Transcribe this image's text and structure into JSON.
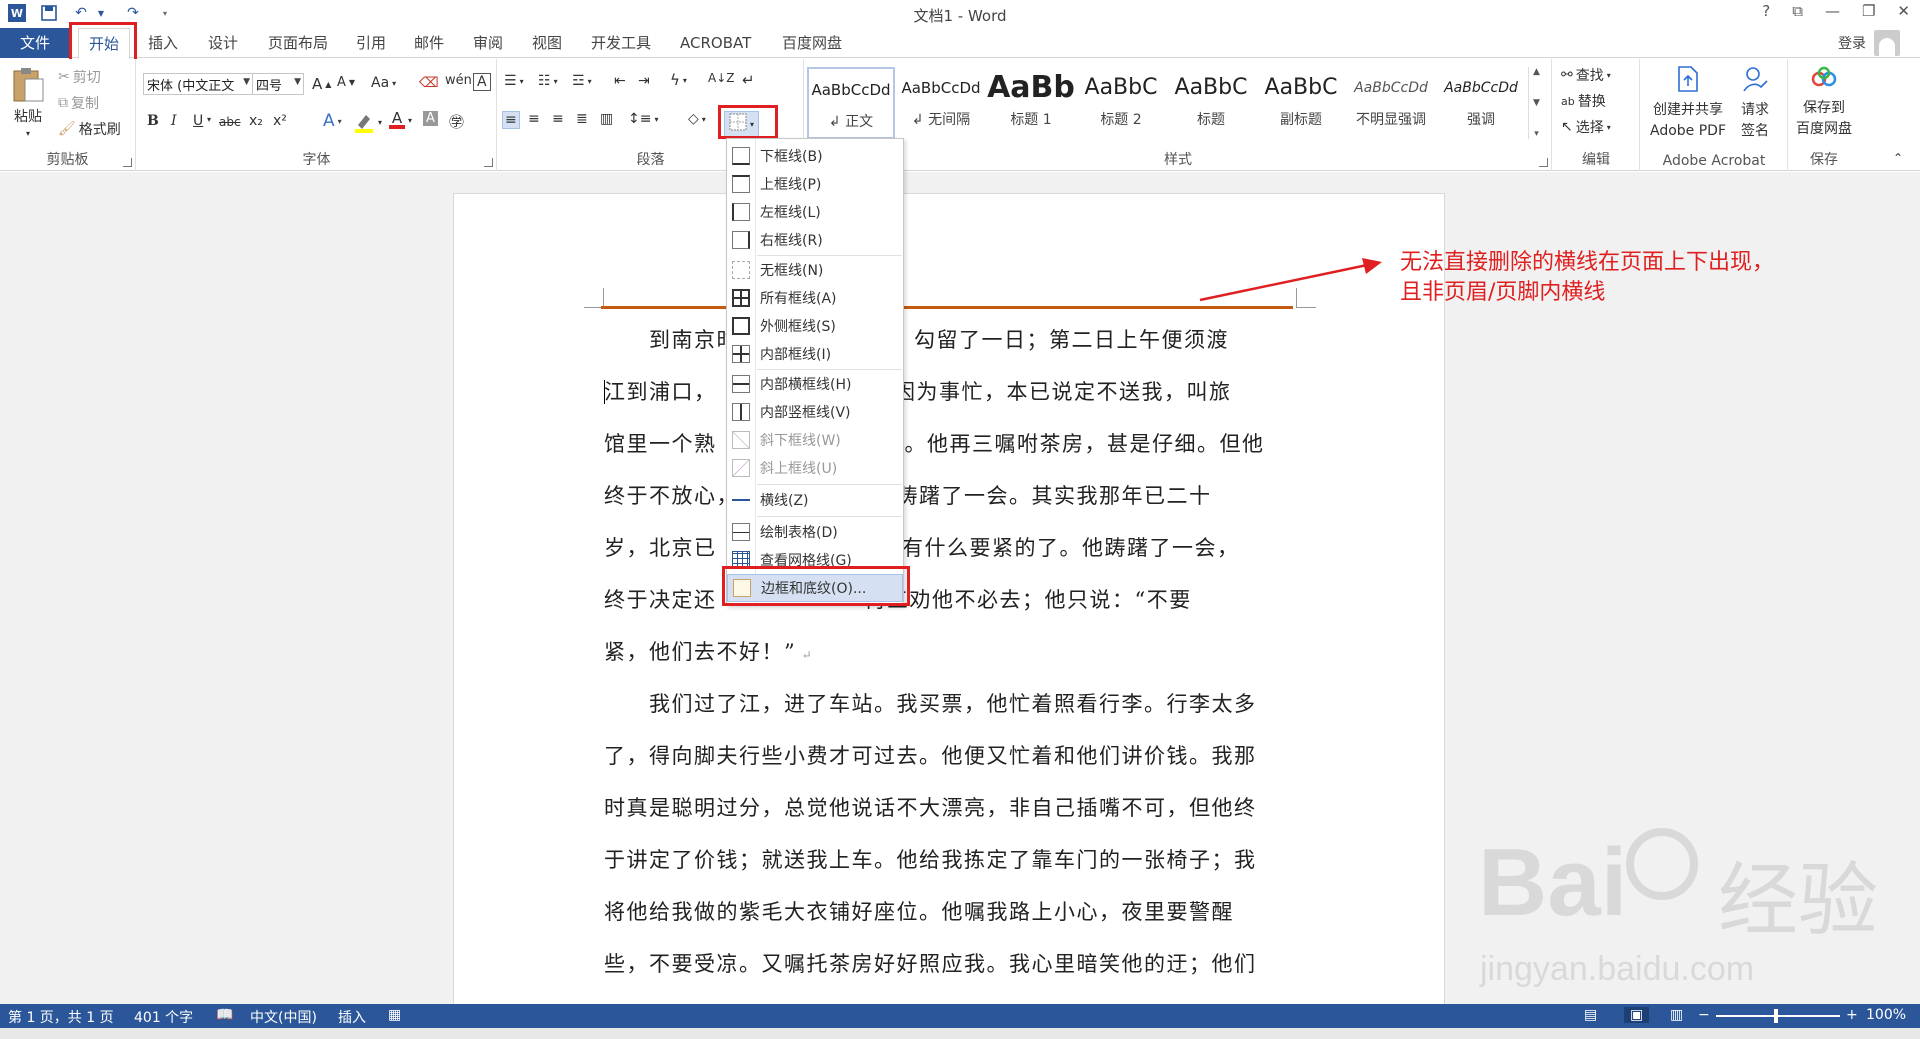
{
  "window": {
    "title": "文档1 - Word",
    "help": "?",
    "restore_icon": "ribbon-display-icon",
    "login": "登录"
  },
  "tabs": [
    "文件",
    "开始",
    "插入",
    "设计",
    "页面布局",
    "引用",
    "邮件",
    "审阅",
    "视图",
    "开发工具",
    "ACROBAT",
    "百度网盘"
  ],
  "clipboard": {
    "paste": "粘贴",
    "cut": "剪切",
    "copy": "复制",
    "format_painter": "格式刷",
    "label": "剪贴板"
  },
  "font": {
    "name": "宋体 (中文正文",
    "size": "四号",
    "label": "字体",
    "bold": "B",
    "italic": "I",
    "underline": "U",
    "strike": "abc",
    "sub": "x₂",
    "sup": "x²",
    "grow": "A",
    "shrink": "A",
    "case": "Aa",
    "font_color": "A",
    "highlight_color": "#ffff00",
    "font_color_value": "#e02020"
  },
  "paragraph": {
    "label": "段落"
  },
  "styles": {
    "label": "样式",
    "items": [
      {
        "sample": "AaBbCcDd",
        "name": "正文"
      },
      {
        "sample": "AaBbCcDd",
        "name": "无间隔"
      },
      {
        "sample": "AaBb",
        "name": "标题 1"
      },
      {
        "sample": "AaBbC",
        "name": "标题 2"
      },
      {
        "sample": "AaBbC",
        "name": "标题"
      },
      {
        "sample": "AaBbC",
        "name": "副标题"
      },
      {
        "sample": "AaBbCcDd",
        "name": "不明显强调"
      },
      {
        "sample": "AaBbCcDd",
        "name": "强调"
      }
    ]
  },
  "editing": {
    "find": "查找",
    "replace": "替换",
    "select": "选择",
    "label": "编辑"
  },
  "acrobat": {
    "create": "创建并共享",
    "create2": "Adobe PDF",
    "sign": "请求",
    "sign2": "签名",
    "label": "Adobe Acrobat"
  },
  "save": {
    "l1": "保存到",
    "l2": "百度网盘",
    "label": "保存"
  },
  "border_menu": {
    "items": [
      {
        "label": "下框线(B)",
        "dim": false
      },
      {
        "label": "上框线(P)",
        "dim": false
      },
      {
        "label": "左框线(L)",
        "dim": false
      },
      {
        "label": "右框线(R)",
        "dim": false
      },
      {
        "label": "无框线(N)",
        "dim": false
      },
      {
        "label": "所有框线(A)",
        "dim": false
      },
      {
        "label": "外侧框线(S)",
        "dim": false
      },
      {
        "label": "内部框线(I)",
        "dim": false
      },
      {
        "label": "内部横框线(H)",
        "dim": false
      },
      {
        "label": "内部竖框线(V)",
        "dim": false
      },
      {
        "label": "斜下框线(W)",
        "dim": true
      },
      {
        "label": "斜上框线(U)",
        "dim": true
      },
      {
        "label": "横线(Z)",
        "dim": false
      },
      {
        "label": "绘制表格(D)",
        "dim": false
      },
      {
        "label": "查看网格线(G)",
        "dim": false
      },
      {
        "label": "边框和底纹(O)...",
        "dim": false
      }
    ]
  },
  "annotation": {
    "line1": "无法直接删除的横线在页面上下出现，",
    "line2": "且非页眉/页脚内横线"
  },
  "document": {
    "lines": [
      "　　到南京时",
      "逛，勾留了一日；第二日上午便须渡",
      "江到浦口，",
      "亲因为事忙，本已说定不送我，叫旅",
      "馆里一个熟",
      "。他再三嘱咐茶房，甚是仔细。但他",
      "终于不放心，",
      "颇踌躇了一会。其实我那年已二十",
      "岁，北京已",
      "没有什么要紧的了。他踌躇了一会，",
      "终于决定还",
      "再三劝他不必去；他只说：“不要",
      "紧，他们去不好！”",
      "　　我们过了江，进了车站。我买票，他忙着照看行李。行李太多",
      "了，得向脚夫行些小费才可过去。他便又忙着和他们讲价钱。我那",
      "时真是聪明过分，总觉他说话不大漂亮，非自己插嘴不可，但他终",
      "于讲定了价钱；就送我上车。他给我拣定了靠车门的一张椅子；我",
      "将他给我做的紫毛大衣铺好座位。他嘱我路上小心，夜里要警醒",
      "些，不要受凉。又嘱托茶房好好照应我。我心里暗笑他的迂；他们"
    ]
  },
  "status": {
    "page": "第 1 页，共 1 页",
    "words": "401 个字",
    "lang": "中文(中国)",
    "mode": "插入",
    "zoom": "100%"
  },
  "watermark": {
    "brand": "Bai",
    "brand2": "经验",
    "url": "jingyan.baidu.com"
  }
}
